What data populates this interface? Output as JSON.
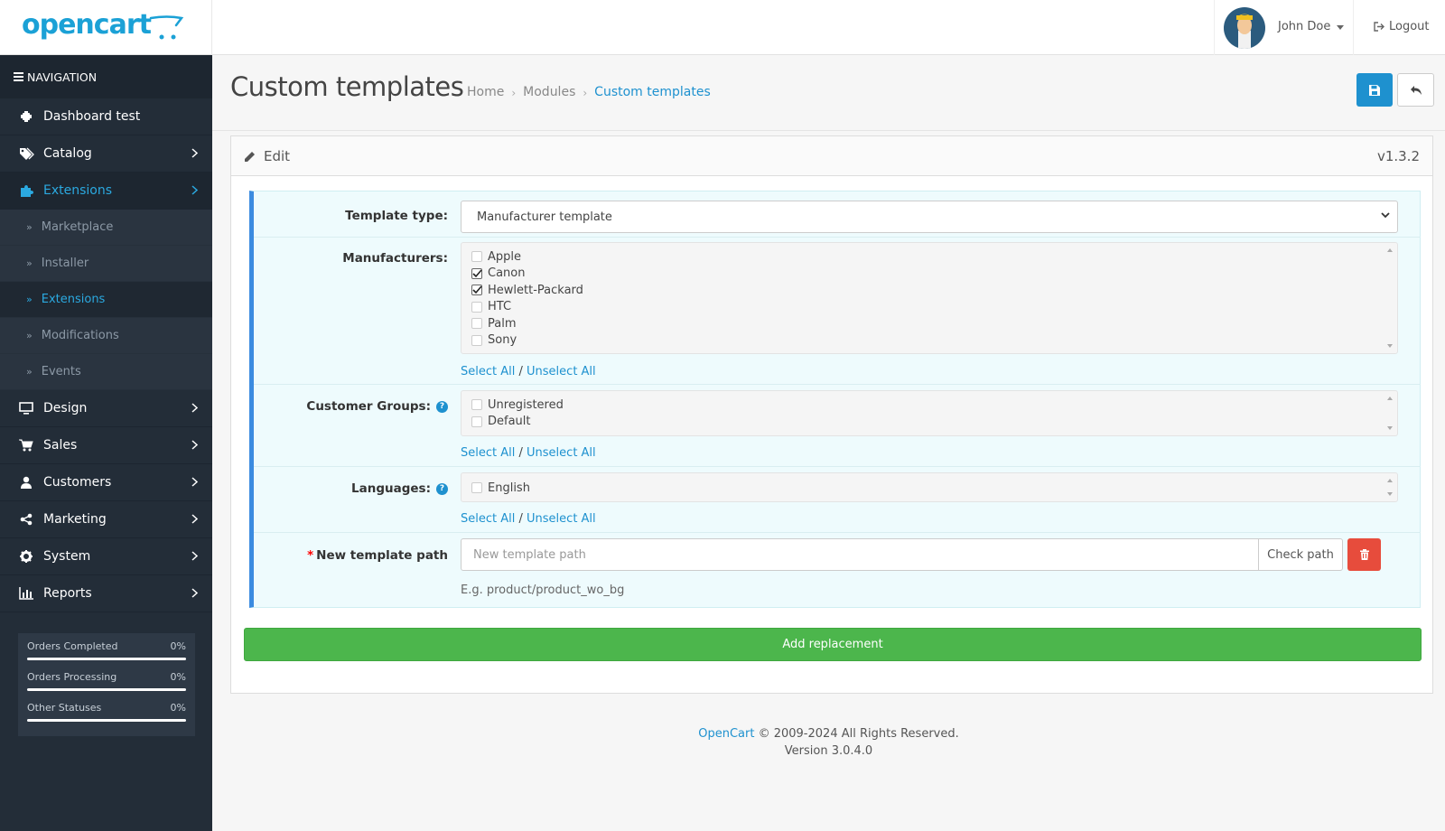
{
  "header": {
    "logo_text": "opencart",
    "user_name": "John Doe",
    "logout_label": "Logout"
  },
  "sidebar": {
    "title": "NAVIGATION",
    "items": [
      {
        "label": "Dashboard test",
        "icon": "dashboard-icon"
      },
      {
        "label": "Catalog",
        "icon": "tags-icon"
      },
      {
        "label": "Extensions",
        "icon": "puzzle-icon",
        "active": true
      },
      {
        "label": "Design",
        "icon": "monitor-icon"
      },
      {
        "label": "Sales",
        "icon": "cart-icon"
      },
      {
        "label": "Customers",
        "icon": "user-icon"
      },
      {
        "label": "Marketing",
        "icon": "share-icon"
      },
      {
        "label": "System",
        "icon": "gear-icon"
      },
      {
        "label": "Reports",
        "icon": "bar-chart-icon"
      }
    ],
    "sub_items": [
      {
        "label": "Marketplace"
      },
      {
        "label": "Installer"
      },
      {
        "label": "Extensions",
        "active": true
      },
      {
        "label": "Modifications"
      },
      {
        "label": "Events"
      }
    ],
    "stats": [
      {
        "label": "Orders Completed",
        "value": "0%"
      },
      {
        "label": "Orders Processing",
        "value": "0%"
      },
      {
        "label": "Other Statuses",
        "value": "0%"
      }
    ]
  },
  "page": {
    "title": "Custom templates",
    "breadcrumb": [
      "Home",
      "Modules",
      "Custom templates"
    ],
    "breadcrumb_sep": "›"
  },
  "panel": {
    "title": "Edit",
    "version": "v1.3.2"
  },
  "form": {
    "template_type": {
      "label": "Template type:",
      "value": "Manufacturer template"
    },
    "manufacturers": {
      "label": "Manufacturers:",
      "options": [
        {
          "name": "Apple",
          "checked": false
        },
        {
          "name": "Canon",
          "checked": true
        },
        {
          "name": "Hewlett-Packard",
          "checked": true
        },
        {
          "name": "HTC",
          "checked": false
        },
        {
          "name": "Palm",
          "checked": false
        },
        {
          "name": "Sony",
          "checked": false
        }
      ]
    },
    "customer_groups": {
      "label": "Customer Groups:",
      "options": [
        {
          "name": "Unregistered",
          "checked": false
        },
        {
          "name": "Default",
          "checked": false
        }
      ]
    },
    "languages": {
      "label": "Languages:",
      "options": [
        {
          "name": "English",
          "checked": false
        }
      ]
    },
    "select_all": "Select All",
    "unselect_all": "Unselect All",
    "slash": "/",
    "template_path": {
      "required_mark": "*",
      "label": "New template path",
      "placeholder": "New template path",
      "check_button": "Check path",
      "help": "E.g. product/product_wo_bg"
    },
    "add_button": "Add replacement"
  },
  "footer": {
    "brand": "OpenCart",
    "copyright": "© 2009-2024 All Rights Reserved.",
    "version": "Version 3.0.4.0"
  },
  "colors": {
    "accent": "#1e91cf",
    "sidebar_bg": "#232d38",
    "success": "#4cb64c",
    "danger": "#e74c3c"
  }
}
